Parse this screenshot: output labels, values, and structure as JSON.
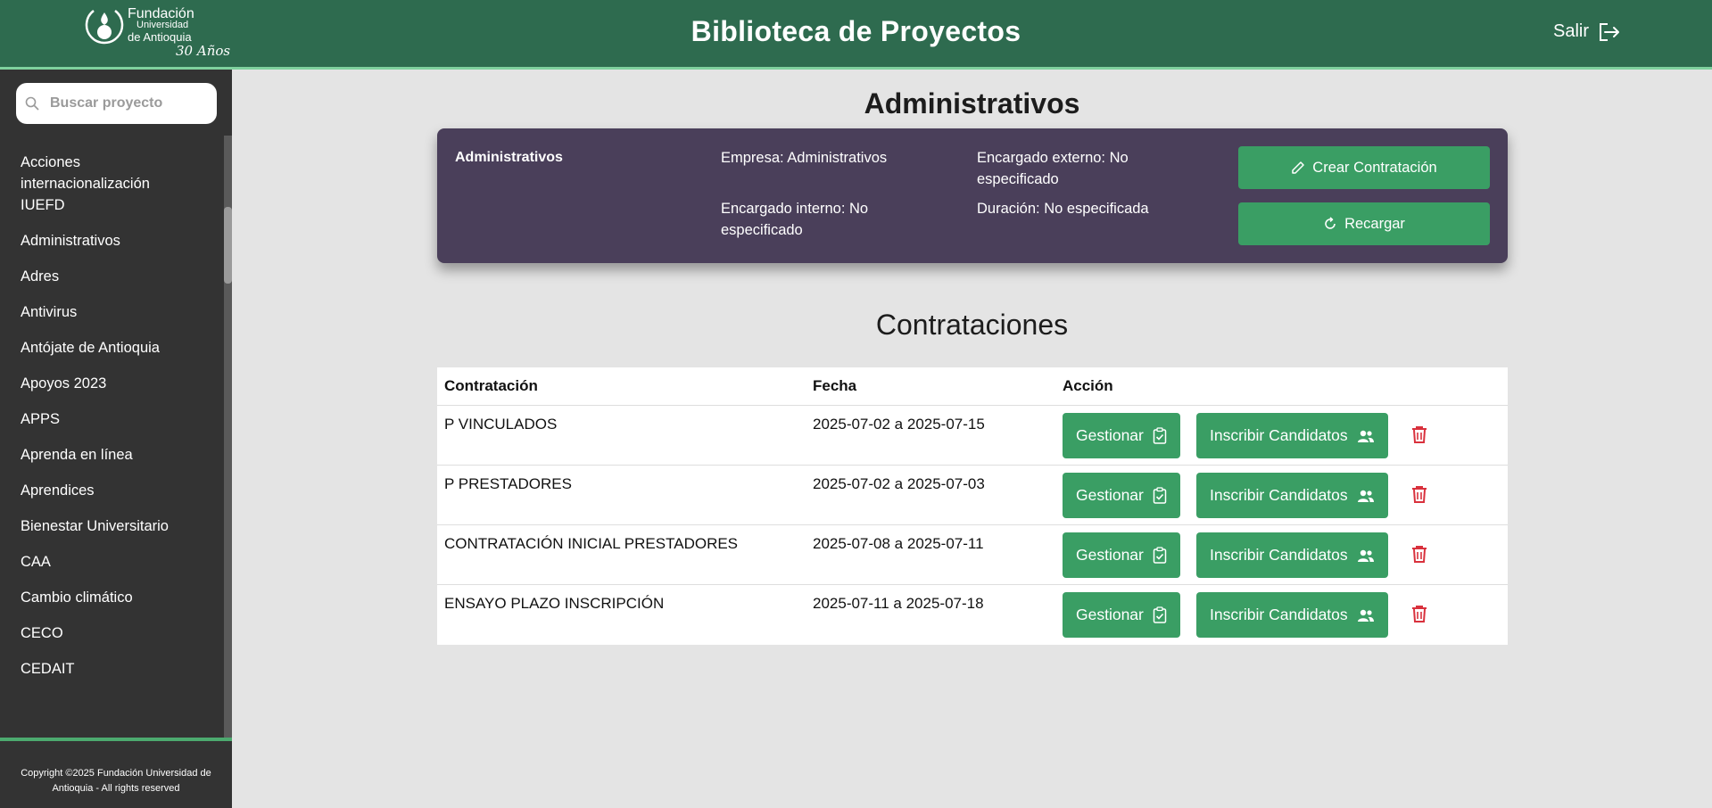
{
  "header": {
    "logo": {
      "line1": "Fundación",
      "line2": "Universidad",
      "line3": "de Antioquia",
      "years": "30 Años"
    },
    "title": "Biblioteca de Proyectos",
    "logout_label": "Salir"
  },
  "sidebar": {
    "search_placeholder": "Buscar proyecto",
    "items": [
      {
        "label": "Acciones internacionalización IUEFD"
      },
      {
        "label": "Administrativos"
      },
      {
        "label": "Adres"
      },
      {
        "label": "Antivirus"
      },
      {
        "label": "Antójate de Antioquia"
      },
      {
        "label": "Apoyos 2023"
      },
      {
        "label": "APPS"
      },
      {
        "label": "Aprenda en línea"
      },
      {
        "label": "Aprendices"
      },
      {
        "label": "Bienestar Universitario"
      },
      {
        "label": "CAA"
      },
      {
        "label": "Cambio climático"
      },
      {
        "label": "CECO"
      },
      {
        "label": "CEDAIT"
      }
    ],
    "footer": "Copyright ©2025 Fundación Universidad de Antioquia - All rights reserved"
  },
  "main": {
    "page_title": "Administrativos",
    "card": {
      "name": "Administrativos",
      "empresa": "Empresa: Administrativos",
      "encargado_interno": "Encargado interno: No especificado",
      "encargado_externo": "Encargado externo: No especificado",
      "duracion": "Duración: No especificada",
      "crear_label": "Crear Contratación",
      "recargar_label": "Recargar"
    },
    "section_title": "Contrataciones",
    "table": {
      "headers": [
        "Contratación",
        "Fecha",
        "Acción"
      ],
      "gestionar_label": "Gestionar",
      "inscribir_label": "Inscribir Candidatos",
      "rows": [
        {
          "name": "P VINCULADOS",
          "fecha": "2025-07-02 a 2025-07-15"
        },
        {
          "name": "P PRESTADORES",
          "fecha": "2025-07-02 a 2025-07-03"
        },
        {
          "name": "CONTRATACIÓN INICIAL PRESTADORES",
          "fecha": "2025-07-08 a 2025-07-11"
        },
        {
          "name": "ENSAYO PLAZO INSCRIPCIÓN",
          "fecha": "2025-07-11 a 2025-07-18"
        }
      ]
    }
  },
  "colors": {
    "header_bg": "#2e6b4f",
    "sidebar_bg": "#333333",
    "card_bg": "#4a3f5a",
    "button_green": "#3a9e64",
    "trash_red": "#d9313d"
  },
  "icons": [
    "logo-icon",
    "logout-icon",
    "search-icon",
    "pencil-icon",
    "refresh-icon",
    "clipboard-check-icon",
    "users-icon",
    "trash-icon"
  ]
}
